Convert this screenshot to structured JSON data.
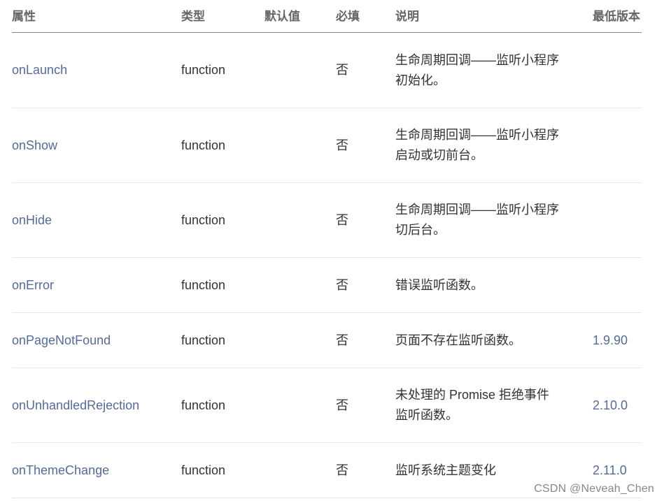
{
  "table": {
    "headers": {
      "prop": "属性",
      "type": "类型",
      "default": "默认值",
      "required": "必填",
      "desc": "说明",
      "version": "最低版本"
    },
    "rows": [
      {
        "prop": "onLaunch",
        "type": "function",
        "default": "",
        "required": "否",
        "desc": "生命周期回调——监听小程序\n初始化。",
        "version": ""
      },
      {
        "prop": "onShow",
        "type": "function",
        "default": "",
        "required": "否",
        "desc": "生命周期回调——监听小程序\n启动或切前台。",
        "version": ""
      },
      {
        "prop": "onHide",
        "type": "function",
        "default": "",
        "required": "否",
        "desc": "生命周期回调——监听小程序\n切后台。",
        "version": ""
      },
      {
        "prop": "onError",
        "type": "function",
        "default": "",
        "required": "否",
        "desc": "错误监听函数。",
        "version": ""
      },
      {
        "prop": "onPageNotFound",
        "type": "function",
        "default": "",
        "required": "否",
        "desc": "页面不存在监听函数。",
        "version": "1.9.90"
      },
      {
        "prop": "onUnhandledRejection",
        "type": "function",
        "default": "",
        "required": "否",
        "desc": "未处理的 Promise 拒绝事件\n监听函数。",
        "version": "2.10.0"
      },
      {
        "prop": "onThemeChange",
        "type": "function",
        "default": "",
        "required": "否",
        "desc": "监听系统主题变化",
        "version": "2.11.0"
      }
    ]
  },
  "watermark": "CSDN @Neveah_Chen",
  "colors": {
    "link": "#576b95",
    "text": "#333333",
    "header": "#666666",
    "divider": "#e8e8e8"
  }
}
